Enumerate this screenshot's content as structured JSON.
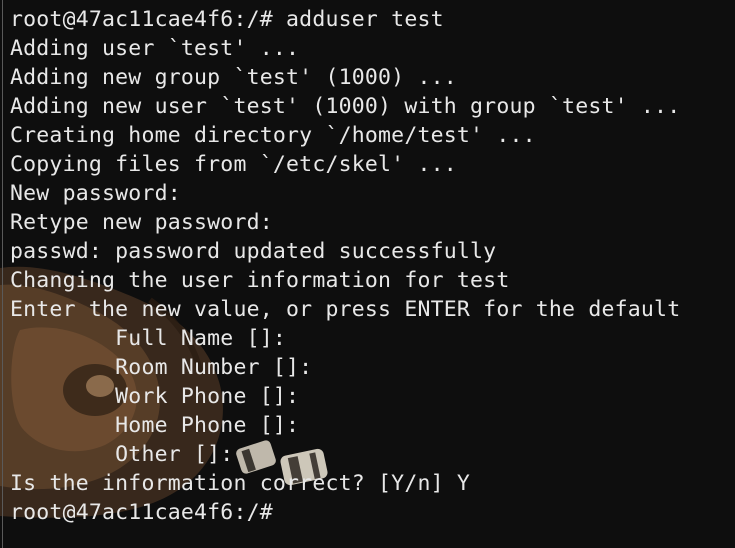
{
  "terminal": {
    "lines": [
      "root@47ac11cae4f6:/# adduser test",
      "Adding user `test' ...",
      "Adding new group `test' (1000) ...",
      "Adding new user `test' (1000) with group `test' ...",
      "Creating home directory `/home/test' ...",
      "Copying files from `/etc/skel' ...",
      "New password:",
      "Retype new password:",
      "passwd: password updated successfully",
      "Changing the user information for test",
      "Enter the new value, or press ENTER for the default",
      "        Full Name []:",
      "        Room Number []:",
      "        Work Phone []:",
      "        Home Phone []:",
      "        Other []:",
      "Is the information correct? [Y/n] Y",
      "root@47ac11cae4f6:/#"
    ]
  },
  "colors": {
    "background": "#0e0e0e",
    "text": "#e8e8e8",
    "wallpaper_brown": "#4a3524"
  }
}
